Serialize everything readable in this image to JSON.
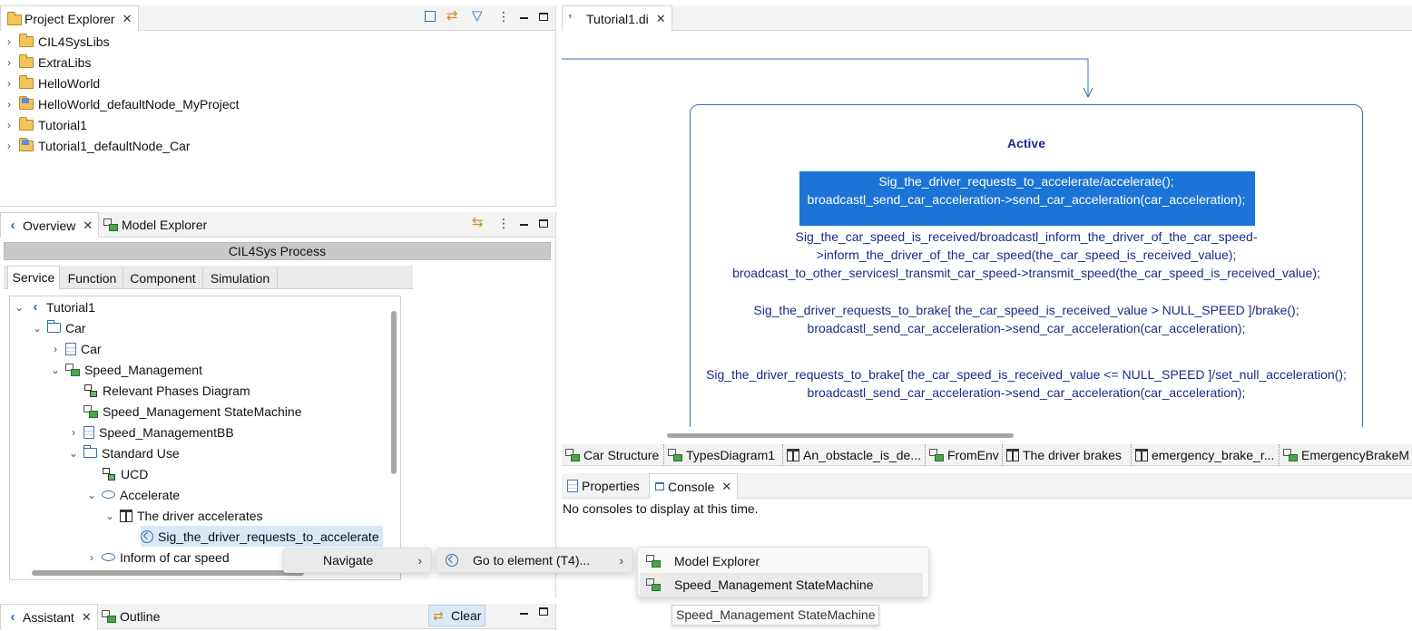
{
  "project_explorer": {
    "tab_label": "Project Explorer",
    "items": [
      "CIL4SysLibs",
      "ExtraLibs",
      "HelloWorld",
      "HelloWorld_defaultNode_MyProject",
      "Tutorial1",
      "Tutorial1_defaultNode_Car"
    ]
  },
  "overview": {
    "tab_label": "Overview",
    "model_explorer_tab": "Model Explorer",
    "process_title": "CIL4Sys Process",
    "subtabs": [
      "Service",
      "Function",
      "Component",
      "Simulation"
    ],
    "tree": [
      {
        "label": "Tutorial1",
        "level": 0,
        "icon": "tutorial-icon",
        "chevron": "down"
      },
      {
        "label": "Car",
        "level": 1,
        "icon": "folder-icon",
        "chevron": "down"
      },
      {
        "label": "Car",
        "level": 2,
        "icon": "block-icon",
        "chevron": "right"
      },
      {
        "label": "Speed_Management",
        "level": 2,
        "icon": "package-icon",
        "chevron": "down"
      },
      {
        "label": "Relevant Phases Diagram",
        "level": 3,
        "icon": "diagram-icon",
        "chevron": ""
      },
      {
        "label": "Speed_Management StateMachine",
        "level": 3,
        "icon": "statemachine-icon",
        "chevron": ""
      },
      {
        "label": "Speed_ManagementBB",
        "level": 3,
        "icon": "block-icon",
        "chevron": "right"
      },
      {
        "label": "Standard Use",
        "level": 3,
        "icon": "folder-icon",
        "chevron": "down"
      },
      {
        "label": "UCD",
        "level": 4,
        "icon": "ucd-icon",
        "chevron": ""
      },
      {
        "label": "Accelerate",
        "level": 4,
        "icon": "usecase-icon",
        "chevron": "down"
      },
      {
        "label": "The driver accelerates",
        "level": 5,
        "icon": "sequence-icon",
        "chevron": "down"
      },
      {
        "label": "Sig_the_driver_requests_to_accelerate",
        "level": 6,
        "icon": "signal-icon",
        "chevron": "",
        "selected": true
      },
      {
        "label": "Inform of car speed",
        "level": 4,
        "icon": "usecase-icon",
        "chevron": "right"
      }
    ]
  },
  "assistant": {
    "tab_label": "Assistant",
    "outline_tab": "Outline",
    "clear_label": "Clear"
  },
  "editor": {
    "tab_label": "Tutorial1.di",
    "state_title": "Active",
    "selected_lines": [
      "Sig_the_driver_requests_to_accelerate/accelerate();",
      "broadcastl_send_car_acceleration->send_car_acceleration(car_acceleration);"
    ],
    "lines": [
      "Sig_the_car_speed_is_received/broadcastl_inform_the_driver_of_the_car_speed-",
      ">inform_the_driver_of_the_car_speed(the_car_speed_is_received_value);",
      "broadcast_to_other_servicesl_transmit_car_speed->transmit_speed(the_car_speed_is_received_value);",
      "Sig_the_driver_requests_to_brake[ the_car_speed_is_received_value > NULL_SPEED   ]/brake();",
      "broadcastl_send_car_acceleration->send_car_acceleration(car_acceleration);",
      "Sig_the_driver_requests_to_brake[ the_car_speed_is_received_value <= NULL_SPEED   ]/set_null_acceleration();",
      "broadcastl_send_car_acceleration->send_car_acceleration(car_acceleration);"
    ],
    "diagram_tabs": [
      "Car Structure",
      "TypesDiagram1",
      "An_obstacle_is_de...",
      "FromEnv",
      "The driver brakes",
      "emergency_brake_r...",
      "EmergencyBrakeM"
    ]
  },
  "console": {
    "properties_tab": "Properties",
    "console_tab": "Console",
    "message": "No consoles to display at this time."
  },
  "context_menu": {
    "navigate": "Navigate",
    "go_to_element": "Go to element (T4)...",
    "targets": [
      "Model Explorer",
      "Speed_Management StateMachine"
    ],
    "tooltip": "Speed_Management StateMachine"
  }
}
